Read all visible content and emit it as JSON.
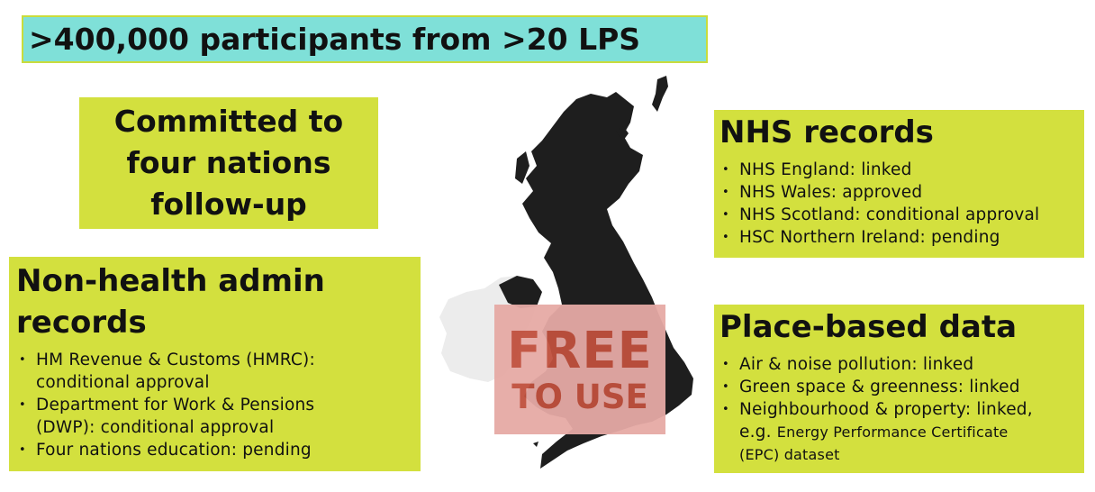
{
  "banner": {
    "text": ">400,000 participants from >20 LPS"
  },
  "commitment": {
    "lines": [
      "Committed to",
      "four nations",
      "follow-up"
    ]
  },
  "non_health": {
    "title_lines": [
      "Non-health admin",
      "records"
    ],
    "items": [
      [
        "HM Revenue & Customs (HMRC):",
        "conditional approval"
      ],
      [
        "Department for Work & Pensions",
        "(DWP): conditional approval"
      ],
      [
        "Four nations education: pending"
      ]
    ]
  },
  "nhs": {
    "title": "NHS records",
    "items": [
      "NHS England: linked",
      "NHS Wales: approved",
      "NHS Scotland: conditional approval",
      "HSC Northern Ireland: pending"
    ]
  },
  "place": {
    "title": "Place-based data",
    "items": [
      "Air & noise pollution: linked",
      "Green space & greenness: linked",
      "Neighbourhood & property: linked,"
    ],
    "item3_line2_prefix": "e.g. ",
    "item3_line2_small": "Energy Performance Certificate",
    "item3_line3": "(EPC) dataset"
  },
  "stamp": {
    "line1": "FREE",
    "line2": "TO USE"
  },
  "bullet_char": "•",
  "colors": {
    "banner": "#7fe0d8",
    "boxes": "#d3e03e",
    "stamp_bg": "#e6aaa5",
    "stamp_text": "#c0503d",
    "map": "#1e1e1e",
    "ireland": "#ececec"
  }
}
